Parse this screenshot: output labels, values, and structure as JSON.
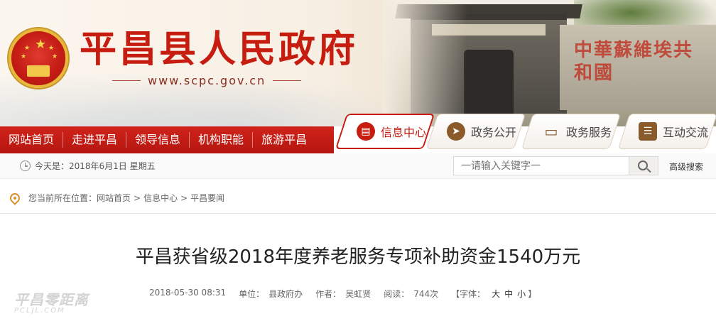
{
  "header": {
    "site_title": "平昌县人民政府",
    "site_url": "www.scpc.gov.cn",
    "scene_text": "中華蘇維埃共和國"
  },
  "nav": {
    "items": [
      {
        "label": "网站首页"
      },
      {
        "label": "走进平昌"
      },
      {
        "label": "领导信息"
      },
      {
        "label": "机构职能"
      },
      {
        "label": "旅游平昌"
      }
    ]
  },
  "tabs": [
    {
      "label": "信息中心",
      "icon": "document-icon",
      "active": true
    },
    {
      "label": "政务公开",
      "icon": "compass-icon",
      "active": false
    },
    {
      "label": "政务服务",
      "icon": "monitor-icon",
      "active": false
    },
    {
      "label": "互动交流",
      "icon": "chat-icon",
      "active": false
    }
  ],
  "infobar": {
    "date": "今天是：2018年6月1日  星期五",
    "search_placeholder": "一请输入关键字一",
    "advanced_search": "高级搜索"
  },
  "breadcrumb": {
    "prefix": "您当前所在位置：",
    "items": [
      "网站首页",
      "信息中心",
      "平昌要闻"
    ]
  },
  "article": {
    "title": "平昌获省级2018年度养老服务专项补助资金1540万元",
    "date": "2018-05-30 08:31",
    "unit_label": "单位：",
    "unit": "县政府办",
    "author_label": "作者：",
    "author": "吴虹贤",
    "reads_label": "阅读：",
    "reads": "744次",
    "font_label": "【字体：",
    "font_large": "大",
    "font_medium": "中",
    "font_small": "小",
    "font_close": "】"
  },
  "watermark": {
    "cn": "平昌零距离",
    "en": "PCLJL.COM"
  },
  "colors": {
    "brand_red": "#c71c10",
    "nav_red": "#c21a13",
    "tab_icon_red": "#c71c10",
    "tab_icon_brown": "#8a5a2b"
  }
}
